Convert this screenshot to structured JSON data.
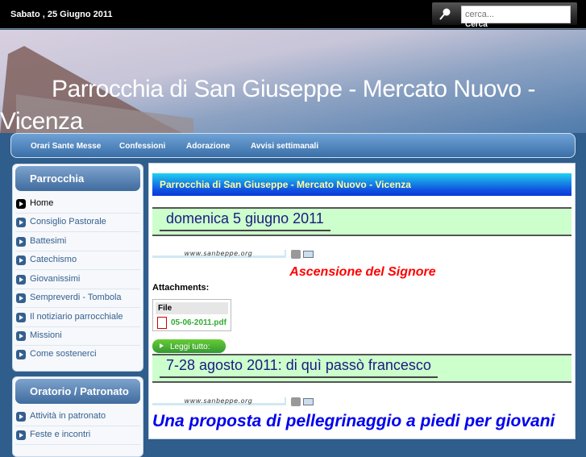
{
  "topbar": {
    "date": "Sabato , 25 Giugno 2011",
    "search_placeholder": "cerca...",
    "search_button": "Cerca"
  },
  "header": {
    "title": "Parrocchia di San Giuseppe - Mercato Nuovo - Vicenza"
  },
  "nav": [
    "Orari Sante Messe",
    "Confessioni",
    "Adorazione",
    "Avvisi settimanali"
  ],
  "sidebar": {
    "panel1": {
      "title": "Parrocchia",
      "items": [
        "Home",
        "Consiglio Pastorale",
        "Battesimi",
        "Catechismo",
        "Giovanissimi",
        "Sempreverdi - Tombola",
        "Il notiziario parrocchiale",
        "Missioni",
        "Come sostenerci"
      ]
    },
    "panel2": {
      "title": "Oratorio / Patronato",
      "items": [
        "Attività in patronato",
        "Feste e incontri"
      ]
    }
  },
  "main": {
    "title": "Parrocchia di San Giuseppe - Mercato Nuovo - Vicenza",
    "watermark": "www.sanbeppe.org",
    "article1": {
      "title": "domenica 5 giugno 2011",
      "subtitle": "Ascensione del Signore",
      "attachments_label": "Attachments:",
      "file_header": "File",
      "file_name": "05-06-2011.pdf",
      "read_more": "Leggi tutto:"
    },
    "article2": {
      "title": "7-28 agosto 2011: di quì passò francesco",
      "subtitle": "Una proposta di pellegrinaggio a piedi per giovani"
    }
  }
}
